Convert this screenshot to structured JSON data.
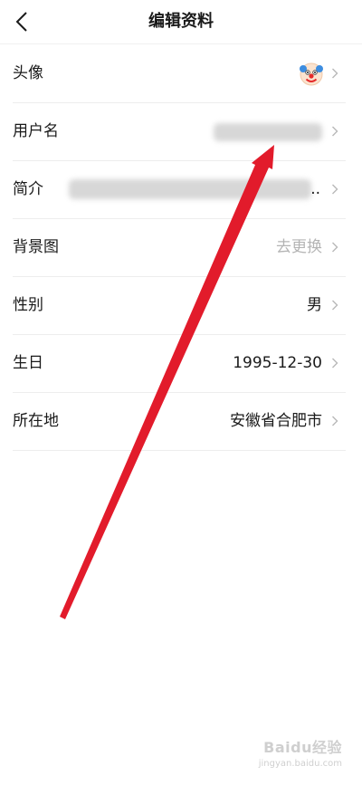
{
  "header": {
    "title": "编辑资料",
    "back_icon": "chevron-left-icon"
  },
  "rows": {
    "avatar": {
      "label": "头像",
      "icon": "clown-face-icon"
    },
    "username": {
      "label": "用户名"
    },
    "bio": {
      "label": "简介",
      "ellipsis": ".."
    },
    "background": {
      "label": "背景图",
      "value": "去更换"
    },
    "gender": {
      "label": "性别",
      "value": "男"
    },
    "birthday": {
      "label": "生日",
      "value": "1995-12-30"
    },
    "location": {
      "label": "所在地",
      "value": "安徽省合肥市"
    }
  },
  "overlay": {
    "arrow_color": "#e21b2b",
    "watermark_logo": "Baidu经验",
    "watermark_url": "jingyan.baidu.com"
  }
}
